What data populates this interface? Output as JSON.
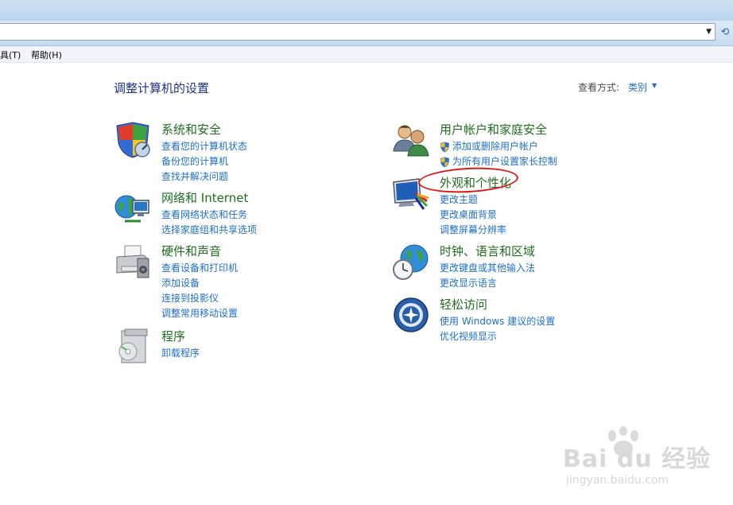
{
  "menu": {
    "tools_label": "具(T)",
    "help_label": "帮助(H)"
  },
  "header": {
    "title": "调整计算机的设置",
    "view_label": "查看方式:",
    "view_value": "类别"
  },
  "categories": [
    {
      "title": "系统和安全",
      "links": [
        "查看您的计算机状态",
        "备份您的计算机",
        "查找并解决问题"
      ],
      "icon": "shield-icon"
    },
    {
      "title": "网络和 Internet",
      "links": [
        "查看网络状态和任务",
        "选择家庭组和共享选项"
      ],
      "icon": "network-globe-icon"
    },
    {
      "title": "硬件和声音",
      "links": [
        "查看设备和打印机",
        "添加设备",
        "连接到投影仪",
        "调整常用移动设置"
      ],
      "icon": "printer-icon"
    },
    {
      "title": "程序",
      "links": [
        "卸载程序"
      ],
      "icon": "programs-icon"
    },
    {
      "title": "用户帐户和家庭安全",
      "links": [
        "添加或删除用户帐户",
        "为所有用户设置家长控制"
      ],
      "icon": "users-icon"
    },
    {
      "title": "外观和个性化",
      "links": [
        "更改主题",
        "更改桌面背景",
        "调整屏幕分辨率"
      ],
      "icon": "monitor-paint-icon"
    },
    {
      "title": "时钟、语言和区域",
      "links": [
        "更改键盘或其他输入法",
        "更改显示语言"
      ],
      "icon": "clock-globe-icon"
    },
    {
      "title": "轻松访问",
      "links": [
        "使用 Windows 建议的设置",
        "优化视频显示"
      ],
      "icon": "ease-of-access-icon"
    }
  ],
  "watermark": {
    "brand": "Bai du 经验",
    "url": "jingyan.baidu.com"
  },
  "colors": {
    "link": "#1e6ec8",
    "category_title": "#1e6e1e",
    "page_title": "#1e3287",
    "highlight": "#e01616"
  }
}
